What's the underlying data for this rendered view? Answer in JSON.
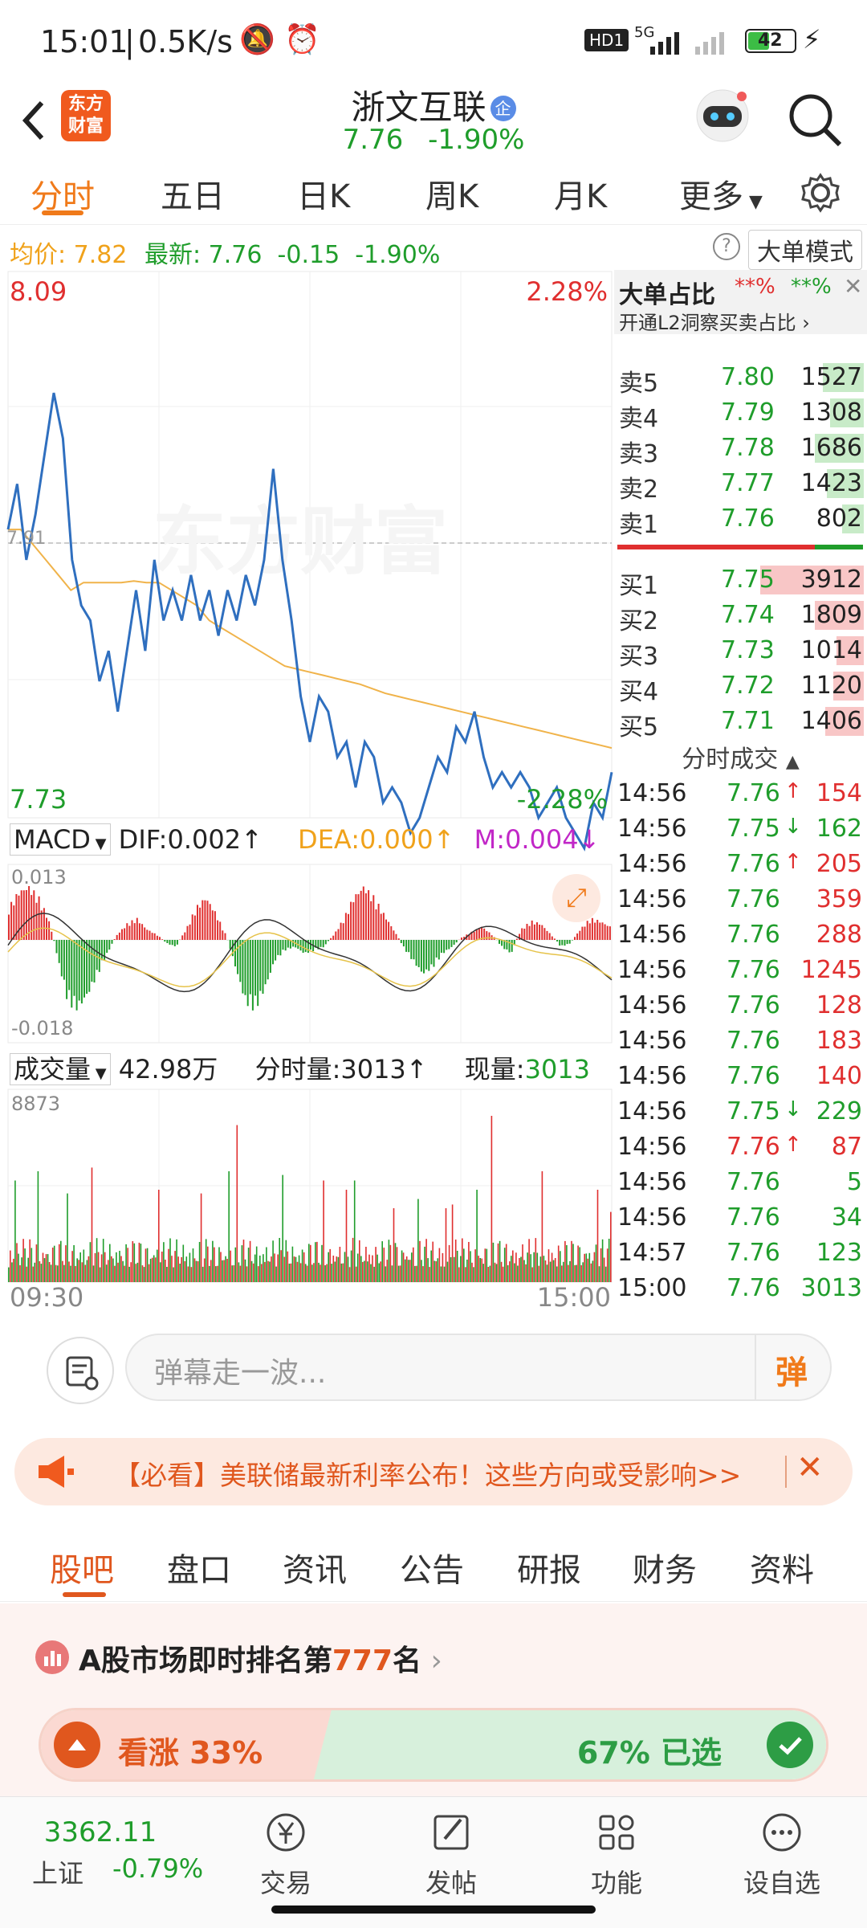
{
  "status": {
    "time": "15:01",
    "speed": "0.5K/s",
    "hd": "HD1",
    "net": "5G",
    "battery": "42"
  },
  "header": {
    "logo_line1": "东方",
    "logo_line2": "财富",
    "stock_name": "浙文互联",
    "stock_badge": "企",
    "price": "7.76",
    "change_pct": "-1.90%"
  },
  "tabs": [
    "分时",
    "五日",
    "日K",
    "周K",
    "月K",
    "更多"
  ],
  "infobar": {
    "avg_label": "均价:",
    "avg_value": "7.82",
    "latest_label": "最新:",
    "latest_value": "7.76",
    "change": "-0.15",
    "change_pct": "-1.90%",
    "mode_button": "大单模式"
  },
  "chart": {
    "price_high": "8.09",
    "pct_high": "2.28%",
    "price_low": "7.73",
    "pct_low": "-2.28%",
    "ref_price": "7.91",
    "watermark": "东方财富",
    "macd_label": "MACD",
    "dif": "DIF:0.002↑",
    "dea": "DEA:0.000↑",
    "m": "M:0.004↓",
    "macd_top": "0.013",
    "macd_bottom": "-0.018",
    "vol_label": "成交量",
    "vol_total": "42.98万",
    "vol_period": "分时量:3013↑",
    "vol_now_label": "现量:",
    "vol_now_value": "3013",
    "vol_max": "8873",
    "time_start": "09:30",
    "time_end": "15:00"
  },
  "chart_data": {
    "type": "line",
    "ylim": [
      7.73,
      8.09
    ],
    "price": [
      7.92,
      7.95,
      7.9,
      7.93,
      7.97,
      8.01,
      7.98,
      7.9,
      7.87,
      7.86,
      7.82,
      7.84,
      7.8,
      7.84,
      7.88,
      7.84,
      7.9,
      7.86,
      7.88,
      7.86,
      7.89,
      7.86,
      7.88,
      7.85,
      7.88,
      7.86,
      7.89,
      7.87,
      7.9,
      7.96,
      7.9,
      7.86,
      7.81,
      7.78,
      7.81,
      7.8,
      7.77,
      7.78,
      7.75,
      7.78,
      7.77,
      7.74,
      7.75,
      7.74,
      7.72,
      7.73,
      7.75,
      7.77,
      7.76,
      7.79,
      7.78,
      7.8,
      7.77,
      7.75,
      7.76,
      7.75,
      7.76,
      7.75,
      7.73,
      7.74,
      7.75,
      7.73,
      7.72,
      7.71,
      7.74,
      7.73,
      7.76
    ],
    "avg": [
      7.92,
      7.92,
      7.91,
      7.9,
      7.89,
      7.88,
      7.885,
      7.885,
      7.885,
      7.885,
      7.886,
      7.885,
      7.885,
      7.88,
      7.875,
      7.87,
      7.86,
      7.855,
      7.85,
      7.845,
      7.84,
      7.835,
      7.83,
      7.828,
      7.826,
      7.824,
      7.822,
      7.82,
      7.818,
      7.815,
      7.812,
      7.81,
      7.808,
      7.806,
      7.804,
      7.802,
      7.8,
      7.798,
      7.796,
      7.794,
      7.792,
      7.79,
      7.788,
      7.786,
      7.784,
      7.782,
      7.78,
      7.778,
      7.776
    ],
    "macd_range": [
      -0.018,
      0.013
    ]
  },
  "orderbook": {
    "header": "大单占比",
    "header_red": "**%",
    "header_green": "**%",
    "promo": "开通L2洞察买卖占比",
    "asks": [
      {
        "label": "卖5",
        "price": "7.80",
        "vol": "1527",
        "ratio": 0.27
      },
      {
        "label": "卖4",
        "price": "7.79",
        "vol": "1308",
        "ratio": 0.22
      },
      {
        "label": "卖3",
        "price": "7.78",
        "vol": "1686",
        "ratio": 0.32
      },
      {
        "label": "卖2",
        "price": "7.77",
        "vol": "1423",
        "ratio": 0.24
      },
      {
        "label": "卖1",
        "price": "7.76",
        "vol": "802",
        "ratio": 0.14
      }
    ],
    "bids": [
      {
        "label": "买1",
        "price": "7.75",
        "vol": "3912",
        "ratio": 0.68
      },
      {
        "label": "买2",
        "price": "7.74",
        "vol": "1809",
        "ratio": 0.32
      },
      {
        "label": "买3",
        "price": "7.73",
        "vol": "1014",
        "ratio": 0.18
      },
      {
        "label": "买4",
        "price": "7.72",
        "vol": "1120",
        "ratio": 0.2
      },
      {
        "label": "买5",
        "price": "7.71",
        "vol": "1406",
        "ratio": 0.25
      }
    ],
    "trades_header": "分时成交",
    "trades": [
      {
        "time": "14:56",
        "price": "7.76",
        "arrow": "↑",
        "vol": "154",
        "pc": "green",
        "vc": "red"
      },
      {
        "time": "14:56",
        "price": "7.75",
        "arrow": "↓",
        "vol": "162",
        "pc": "green",
        "vc": "green"
      },
      {
        "time": "14:56",
        "price": "7.76",
        "arrow": "↑",
        "vol": "205",
        "pc": "green",
        "vc": "red"
      },
      {
        "time": "14:56",
        "price": "7.76",
        "arrow": "",
        "vol": "359",
        "pc": "green",
        "vc": "red"
      },
      {
        "time": "14:56",
        "price": "7.76",
        "arrow": "",
        "vol": "288",
        "pc": "green",
        "vc": "red"
      },
      {
        "time": "14:56",
        "price": "7.76",
        "arrow": "",
        "vol": "1245",
        "pc": "green",
        "vc": "red"
      },
      {
        "time": "14:56",
        "price": "7.76",
        "arrow": "",
        "vol": "128",
        "pc": "green",
        "vc": "red"
      },
      {
        "time": "14:56",
        "price": "7.76",
        "arrow": "",
        "vol": "183",
        "pc": "green",
        "vc": "red"
      },
      {
        "time": "14:56",
        "price": "7.76",
        "arrow": "",
        "vol": "140",
        "pc": "green",
        "vc": "red"
      },
      {
        "time": "14:56",
        "price": "7.75",
        "arrow": "↓",
        "vol": "229",
        "pc": "green",
        "vc": "green"
      },
      {
        "time": "14:56",
        "price": "7.76",
        "arrow": "↑",
        "vol": "87",
        "pc": "red",
        "vc": "red"
      },
      {
        "time": "14:56",
        "price": "7.76",
        "arrow": "",
        "vol": "5",
        "pc": "green",
        "vc": "green"
      },
      {
        "time": "14:56",
        "price": "7.76",
        "arrow": "",
        "vol": "34",
        "pc": "green",
        "vc": "green"
      },
      {
        "time": "14:57",
        "price": "7.76",
        "arrow": "",
        "vol": "123",
        "pc": "green",
        "vc": "green"
      },
      {
        "time": "15:00",
        "price": "7.76",
        "arrow": "",
        "vol": "3013",
        "pc": "green",
        "vc": "green"
      }
    ]
  },
  "danmu": {
    "placeholder": "弹幕走一波...",
    "send": "弹"
  },
  "banner": {
    "text": "【必看】美联储最新利率公布！这些方向或受影响>>"
  },
  "subtabs": [
    "股吧",
    "盘口",
    "资讯",
    "公告",
    "研报",
    "财务",
    "资料"
  ],
  "ranking": {
    "prefix": "A股市场即时排名第",
    "rank": "777",
    "suffix": "名"
  },
  "vote": {
    "up_label": "看涨 33%",
    "down_label": "67% 已选",
    "up_pct": 33
  },
  "bottom": {
    "index_value": "3362.11",
    "index_name": "上证",
    "index_change": "-0.79%",
    "items": [
      "交易",
      "发帖",
      "功能",
      "设自选"
    ]
  },
  "colors": {
    "red": "#e02f2f",
    "green": "#1f9d2b",
    "accent": "#f07a1a"
  }
}
